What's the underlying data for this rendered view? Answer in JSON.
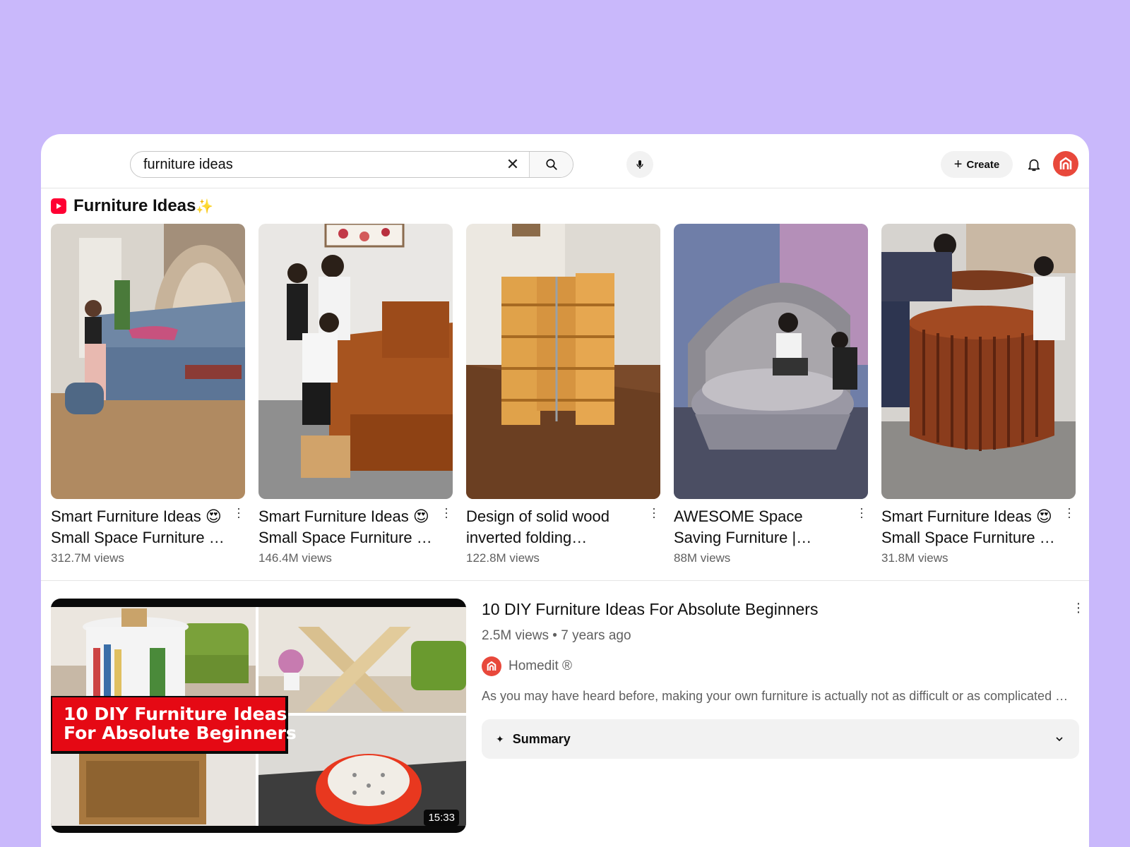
{
  "search": {
    "value": "furniture ideas",
    "clear_icon": "close-icon",
    "search_icon": "search-icon",
    "mic_icon": "microphone-icon"
  },
  "header": {
    "create_label": "Create",
    "bell_icon": "bell-icon"
  },
  "shorts": {
    "title": "Furniture Ideas",
    "sparkle": "✨",
    "items": [
      {
        "title": "Smart Furniture Ideas 😍 Small Space Furniture …",
        "views": "312.7M views"
      },
      {
        "title": "Smart Furniture Ideas 😍 Small Space Furniture …",
        "views": "146.4M views"
      },
      {
        "title": "Design of solid wood inverted folding…",
        "views": "122.8M views"
      },
      {
        "title": "AWESOME Space Saving Furniture | Murphy Bed…",
        "views": "88M views"
      },
      {
        "title": "Smart Furniture Ideas 😍 Small Space Furniture …",
        "views": "31.8M views"
      }
    ]
  },
  "video": {
    "thumbnail_text_line1": "10 DIY Furniture Ideas",
    "thumbnail_text_line2": "For Absolute Beginners",
    "duration": "15:33",
    "title": "10 DIY Furniture Ideas For Absolute Beginners",
    "meta": "2.5M views • 7 years ago",
    "channel": "Homedit ®",
    "description": "As you may have heard before, making your own furniture is actually not as difficult or as complicated as you may think.",
    "summary_label": "Summary"
  },
  "colors": {
    "background": "#c9b8fb",
    "brand_red": "#ff0033",
    "avatar": "#e8483b"
  }
}
